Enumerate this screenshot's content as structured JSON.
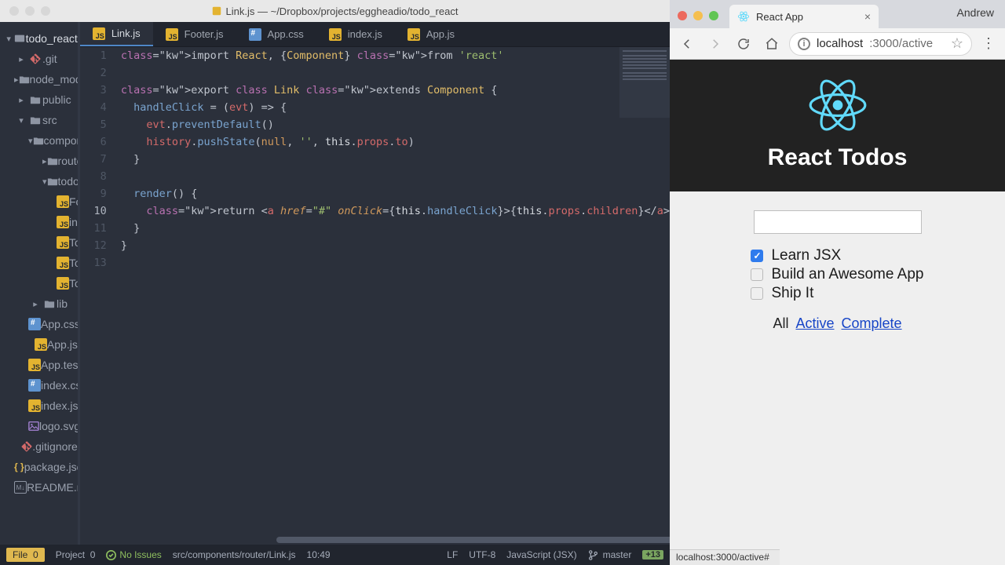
{
  "editor": {
    "title": "Link.js — ~/Dropbox/projects/eggheadio/todo_react",
    "project_name": "todo_react",
    "tree": {
      "root": "todo_react",
      "git": ".git",
      "node_modules": "node_modules",
      "public": "public",
      "src": "src",
      "components": "components",
      "router": "router",
      "todo": "todo",
      "footer": "Footer.js",
      "index_todo": "index.js",
      "todoform": "TodoForm.js",
      "todoitem": "TodoItem.js",
      "todolist": "TodoList.js",
      "lib": "lib",
      "appcss": "App.css",
      "appjs": "App.js",
      "apptest": "App.test.js",
      "indexcss": "index.css",
      "indexjs": "index.js",
      "logosvg": "logo.svg",
      "gitignore": ".gitignore",
      "packagejson": "package.json",
      "readme": "README.md"
    },
    "tabs": [
      {
        "label": "Link.js",
        "active": true,
        "icon": "js"
      },
      {
        "label": "Footer.js",
        "active": false,
        "icon": "js"
      },
      {
        "label": "App.css",
        "active": false,
        "icon": "css"
      },
      {
        "label": "index.js",
        "active": false,
        "icon": "js"
      },
      {
        "label": "App.js",
        "active": false,
        "icon": "js"
      }
    ],
    "code_lines": [
      "import React, {Component} from 'react'",
      "",
      "export class Link extends Component {",
      "  handleClick = (evt) => {",
      "    evt.preventDefault()",
      "    history.pushState(null, '', this.props.to)",
      "  }",
      "",
      "  render() {",
      "    return <a href=\"#\" onClick={this.handleClick}>{this.props.children}</a>",
      "  }",
      "}",
      ""
    ],
    "highlighted_line": 10,
    "statusbar": {
      "file_label": "File",
      "file_count": "0",
      "project_label": "Project",
      "project_count": "0",
      "issues": "No Issues",
      "path": "src/components/router/Link.js",
      "cursor": "10:49",
      "eol": "LF",
      "encoding": "UTF-8",
      "lang": "JavaScript (JSX)",
      "branch": "master",
      "diff": "+13"
    }
  },
  "browser": {
    "tab_title": "React App",
    "user": "Andrew",
    "url_host": "localhost",
    "url_rest": ":3000/active",
    "page_title": "React Todos",
    "todos": [
      {
        "label": "Learn JSX",
        "checked": true
      },
      {
        "label": "Build an Awesome App",
        "checked": false
      },
      {
        "label": "Ship It",
        "checked": false
      }
    ],
    "filters": [
      "All",
      "Active",
      "Complete"
    ],
    "status_url": "localhost:3000/active#"
  }
}
